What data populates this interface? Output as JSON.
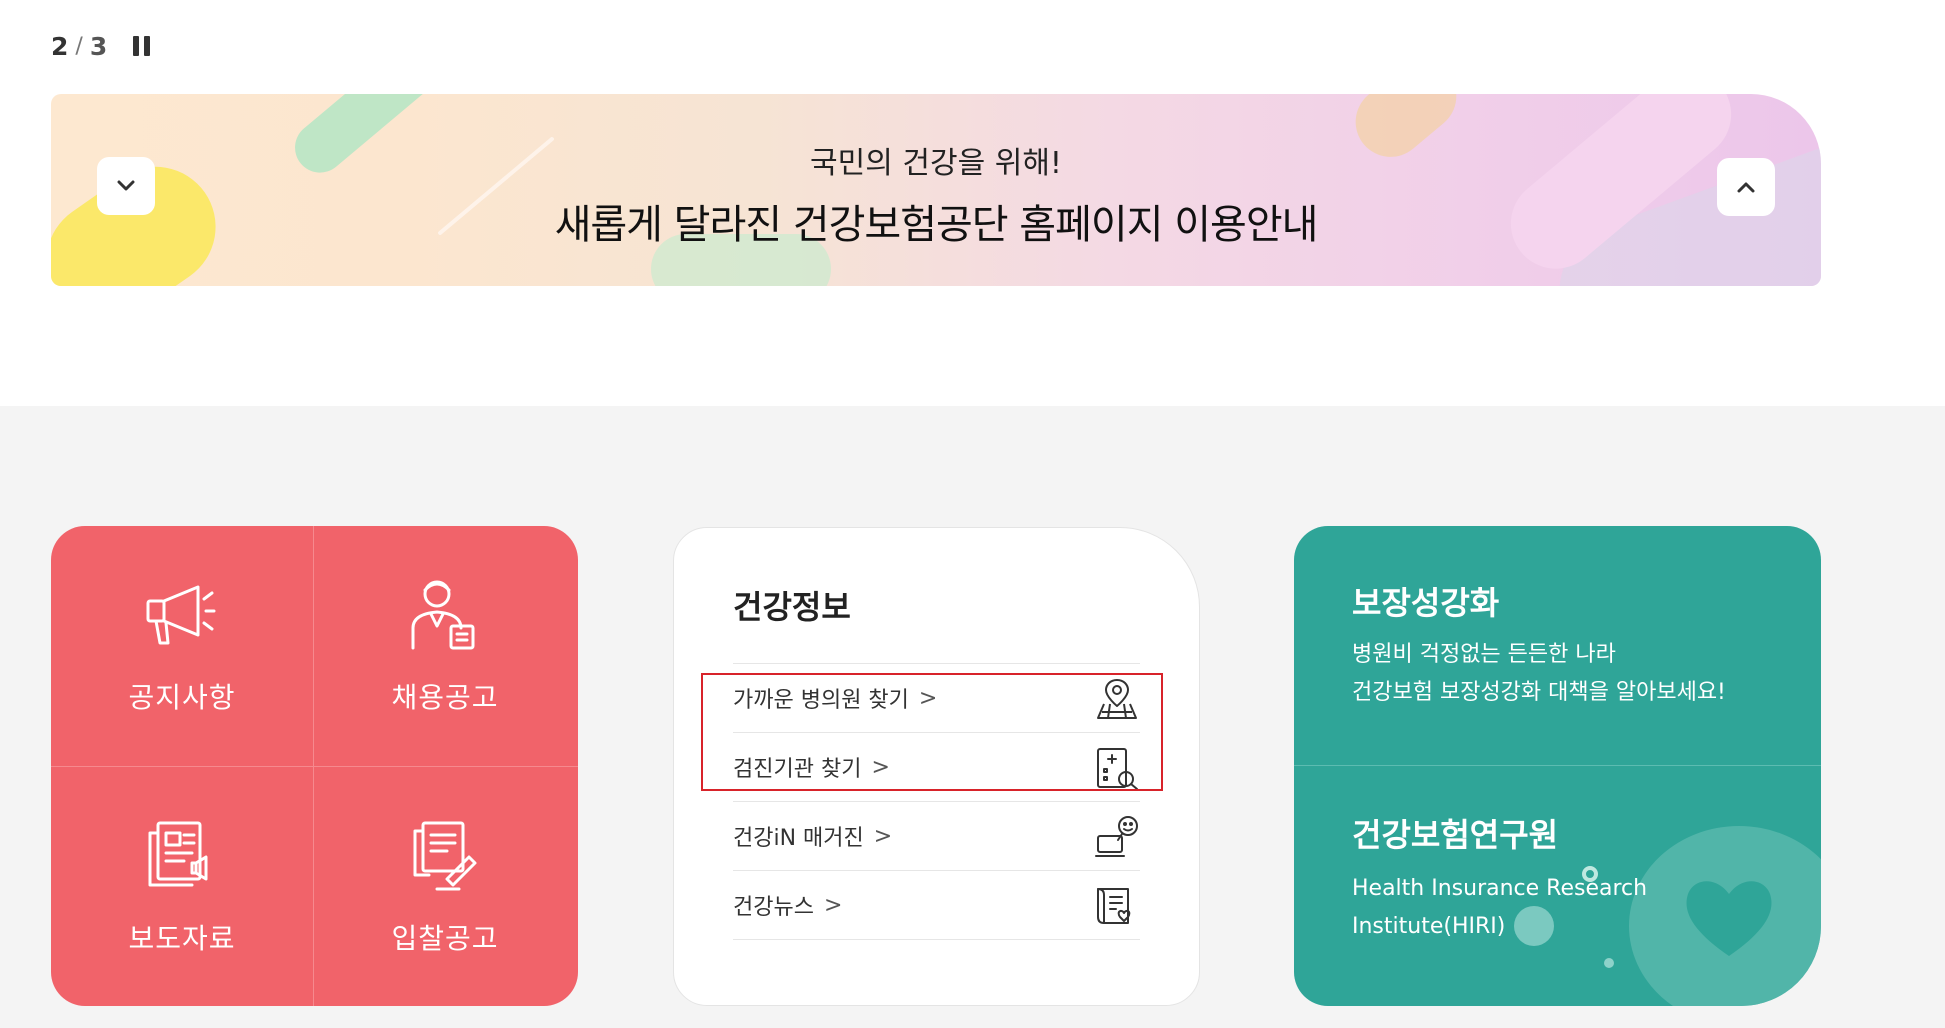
{
  "pager": {
    "current": "2",
    "separator": "/",
    "total": "3"
  },
  "banner": {
    "subtitle": "국민의 건강을 위해!",
    "title": "새롭게 달라진 건강보험공단 홈페이지 이용안내"
  },
  "quick_menu": {
    "items": [
      {
        "label": "공지사항",
        "icon": "megaphone-icon"
      },
      {
        "label": "채용공고",
        "icon": "recruit-person-icon"
      },
      {
        "label": "보도자료",
        "icon": "press-release-icon"
      },
      {
        "label": "입찰공고",
        "icon": "bid-document-icon"
      }
    ],
    "color": "#f1636a"
  },
  "health_info": {
    "title": "건강정보",
    "items": [
      {
        "label": "가까운 병의원 찾기",
        "icon": "map-pin-icon"
      },
      {
        "label": "검진기관 찾기",
        "icon": "hospital-search-icon"
      },
      {
        "label": "건강iN 매거진",
        "icon": "magazine-laptop-icon"
      },
      {
        "label": "건강뉴스",
        "icon": "news-heart-icon"
      }
    ],
    "chevron": ">"
  },
  "promo": {
    "coverage": {
      "title": "보장성강화",
      "line1": "병원비 걱정없는 든든한 나라",
      "line2": "건강보험 보장성강화 대책을 알아보세요!"
    },
    "institute": {
      "title": "건강보험연구원",
      "desc": "Health Insurance Research Institute(HIRI)"
    },
    "color": "#2fa598"
  }
}
